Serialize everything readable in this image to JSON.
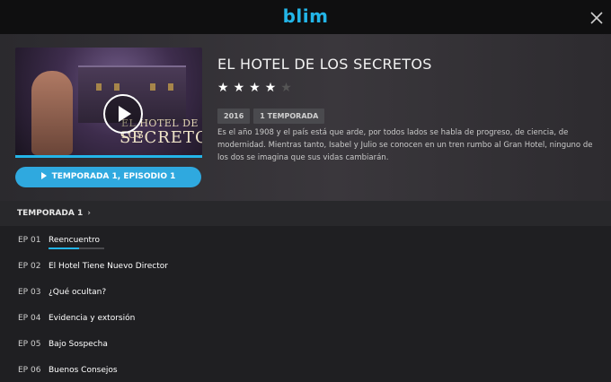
{
  "header": {
    "logo": "blim",
    "close_icon": "close-icon"
  },
  "show": {
    "title": "EL HOTEL DE LOS SECRETOS",
    "thumbnail_title_line1": "EL HOTEL DE LOS",
    "thumbnail_title_line2": "SECRETOS",
    "rating": 4,
    "rating_max": 5,
    "year": "2016",
    "seasons_badge": "1 TEMPORADA",
    "description": "Es el año 1908 y el país está que arde, por todos lados se habla de progreso, de ciencia, de modernidad. Mientras tanto, Isabel y Julio se conocen en un tren rumbo al Gran Hotel, ninguno de los dos se imagina que sus vidas cambiarán.",
    "watch_progress": 1.0,
    "play_button_label": "TEMPORADA 1, EPISODIO 1"
  },
  "season": {
    "label": "TEMPORADA 1"
  },
  "episodes": [
    {
      "num": "EP 01",
      "title": "Reencuentro",
      "progress": 0.55
    },
    {
      "num": "EP 02",
      "title": "El Hotel Tiene Nuevo Director",
      "progress": 0
    },
    {
      "num": "EP 03",
      "title": "¿Qué ocultan?",
      "progress": 0
    },
    {
      "num": "EP 04",
      "title": "Evidencia y extorsión",
      "progress": 0
    },
    {
      "num": "EP 05",
      "title": "Bajo Sospecha",
      "progress": 0
    },
    {
      "num": "EP 06",
      "title": "Buenos Consejos",
      "progress": 0
    }
  ],
  "colors": {
    "accent": "#23b5e8",
    "button": "#2fa9df"
  }
}
